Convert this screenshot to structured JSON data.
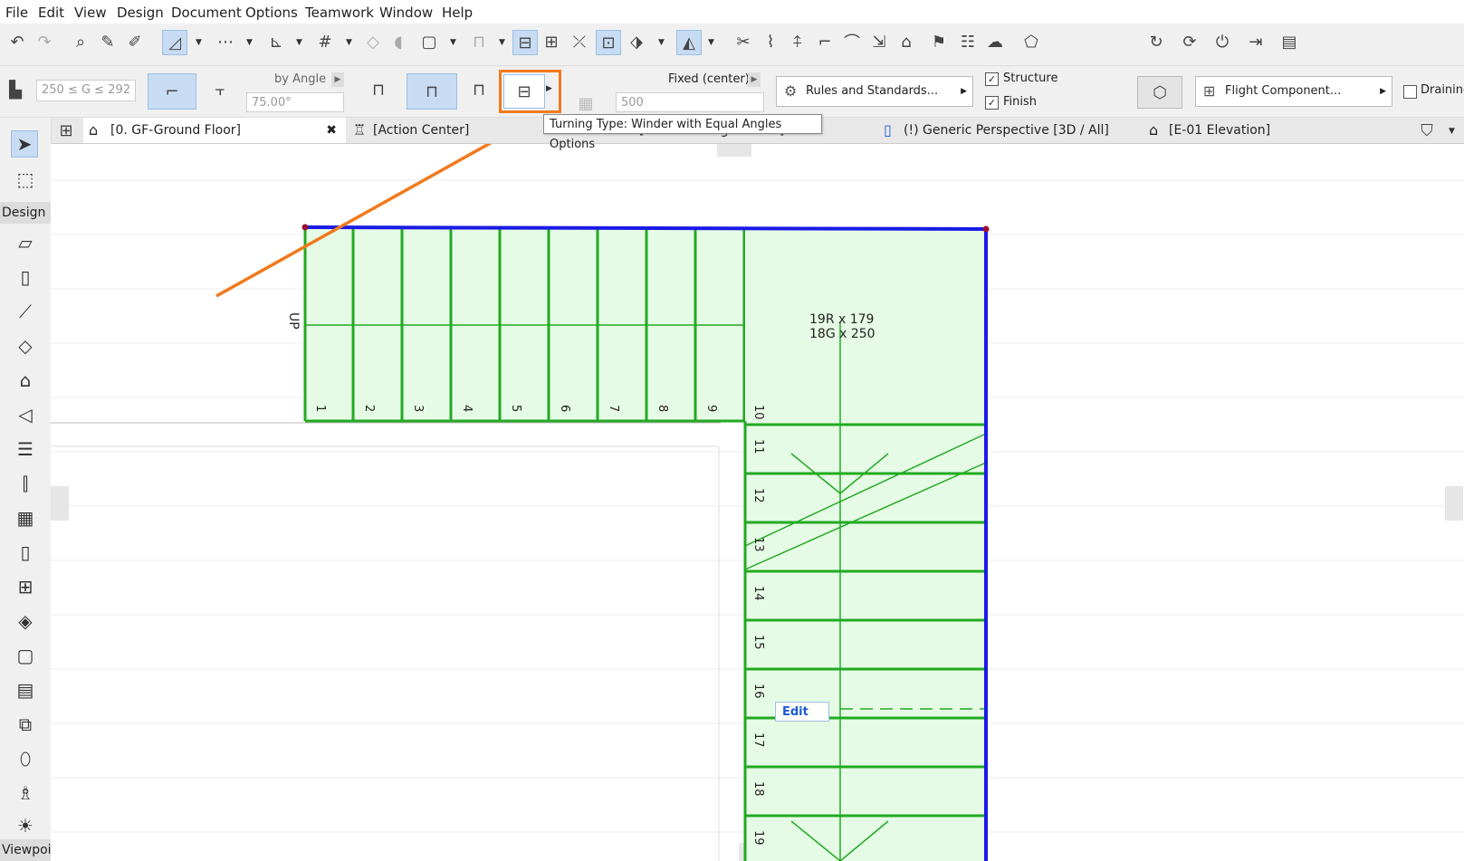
{
  "menu": [
    "File",
    "Edit",
    "View",
    "Design",
    "Document",
    "Options",
    "Teamwork",
    "Window",
    "Help"
  ],
  "infobox": {
    "goal_range": "250 ≤ G ≤ 292",
    "by_angle_label": "by Angle",
    "angle_value": "75.00°",
    "fixed_label": "Fixed (center)",
    "fixed_value": "500",
    "rules_button": "Rules and Standards...",
    "structure_label": "Structure",
    "finish_label": "Finish",
    "flight_button": "Flight Component...",
    "draining_label": "Draining",
    "turning_tooltip": "Turning Type: Winder with Equal Angles Options"
  },
  "tabs": [
    {
      "label": "[0. GF-Ground Floor]"
    },
    {
      "label": "[Action Center]"
    },
    {
      "label": "[S-01 Building Section]"
    },
    {
      "label": "(!) Generic Perspective [3D / All]"
    },
    {
      "label": "[E-01 Elevation]"
    }
  ],
  "toolbox": {
    "design_label": "Design",
    "viewpoint_label": "Viewpoir"
  },
  "stair": {
    "up_label": "UP",
    "riser_info": "19R x 179",
    "going_info": "18G x 250",
    "edit_label": "Edit",
    "step_numbers": [
      "1",
      "2",
      "3",
      "4",
      "5",
      "6",
      "7",
      "8",
      "9",
      "10",
      "11",
      "12",
      "13",
      "14",
      "15",
      "16",
      "17",
      "18",
      "19"
    ]
  },
  "colors": {
    "accent": "#f07a1c",
    "stair_green": "#22aa22",
    "stair_fill": "#e6fbe6",
    "boundary_blue": "#1a1ae6",
    "selection": "#c7dcf2"
  }
}
